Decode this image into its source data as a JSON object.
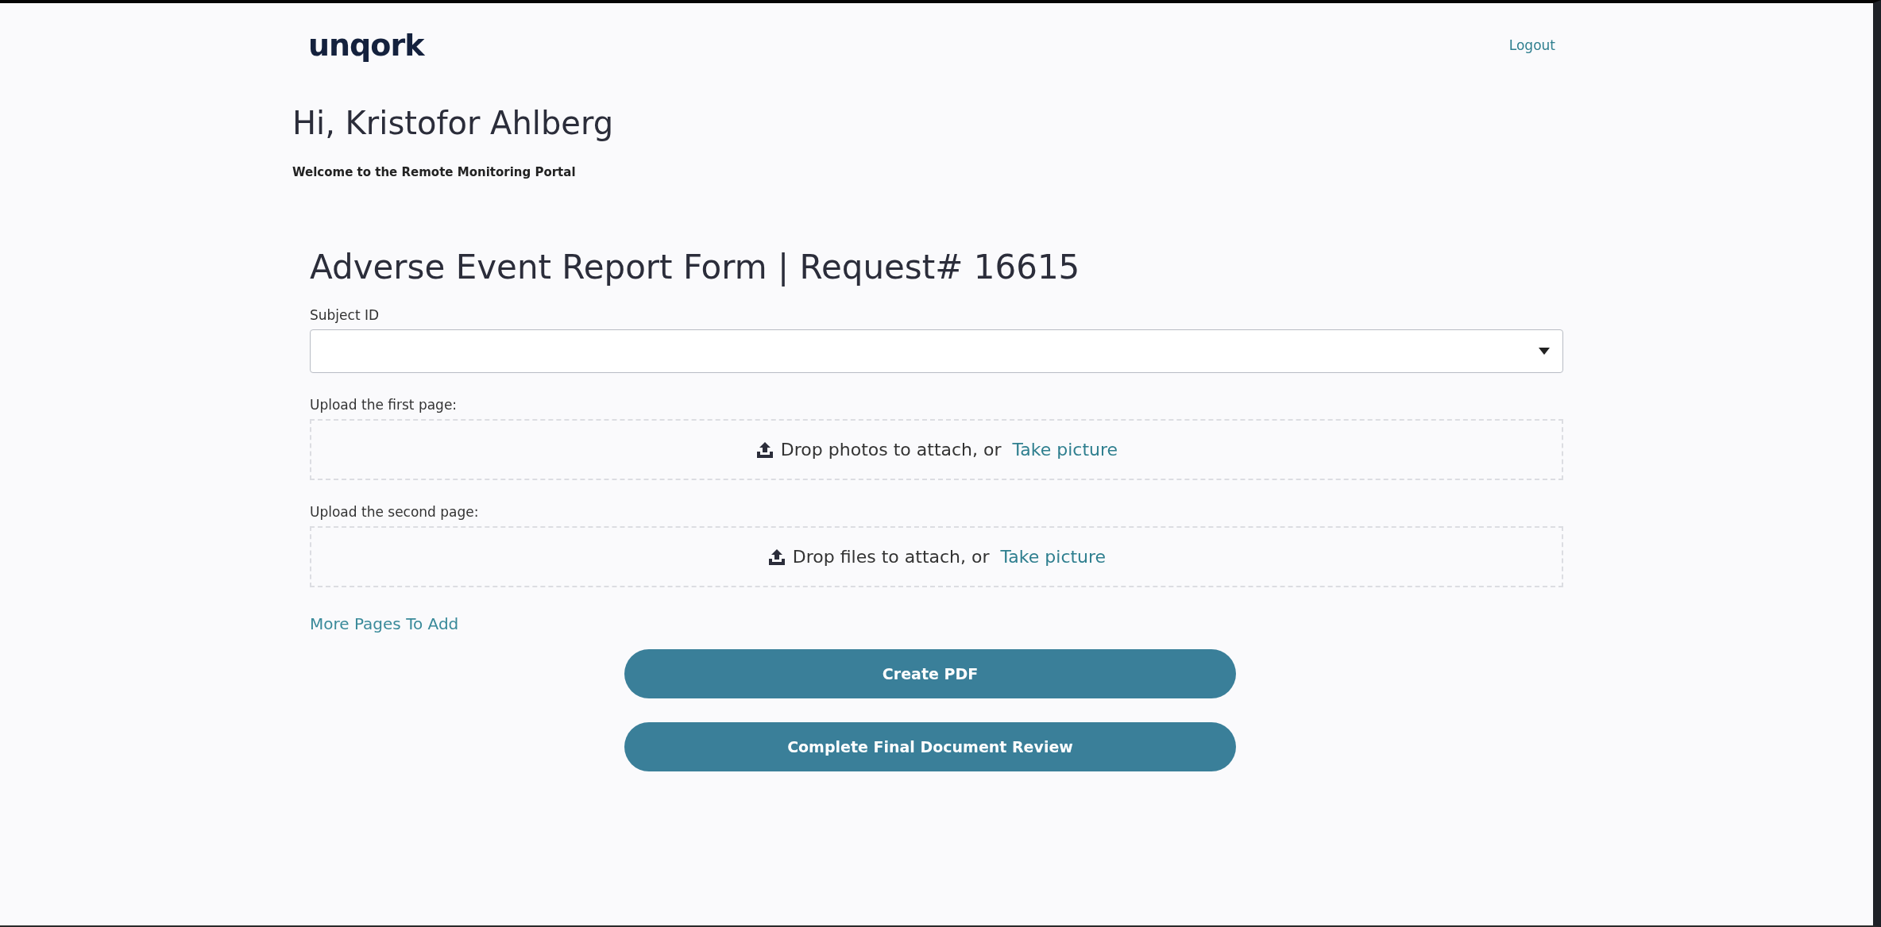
{
  "header": {
    "logo": "unqork",
    "logout": "Logout"
  },
  "greeting": {
    "title": "Hi, Kristofor Ahlberg",
    "subtitle": "Welcome to the Remote Monitoring Portal"
  },
  "form": {
    "title": "Adverse Event Report Form | Request# 16615",
    "subject": {
      "label": "Subject ID"
    },
    "uploads": [
      {
        "label": "Upload the first page:",
        "prompt": "Drop photos to attach, or",
        "link": "Take picture"
      },
      {
        "label": "Upload the second page:",
        "prompt": "Drop files to attach, or",
        "link": "Take picture"
      }
    ],
    "more_link": "More Pages To Add",
    "buttons": [
      "Create PDF",
      "Complete Final Document Review"
    ]
  }
}
